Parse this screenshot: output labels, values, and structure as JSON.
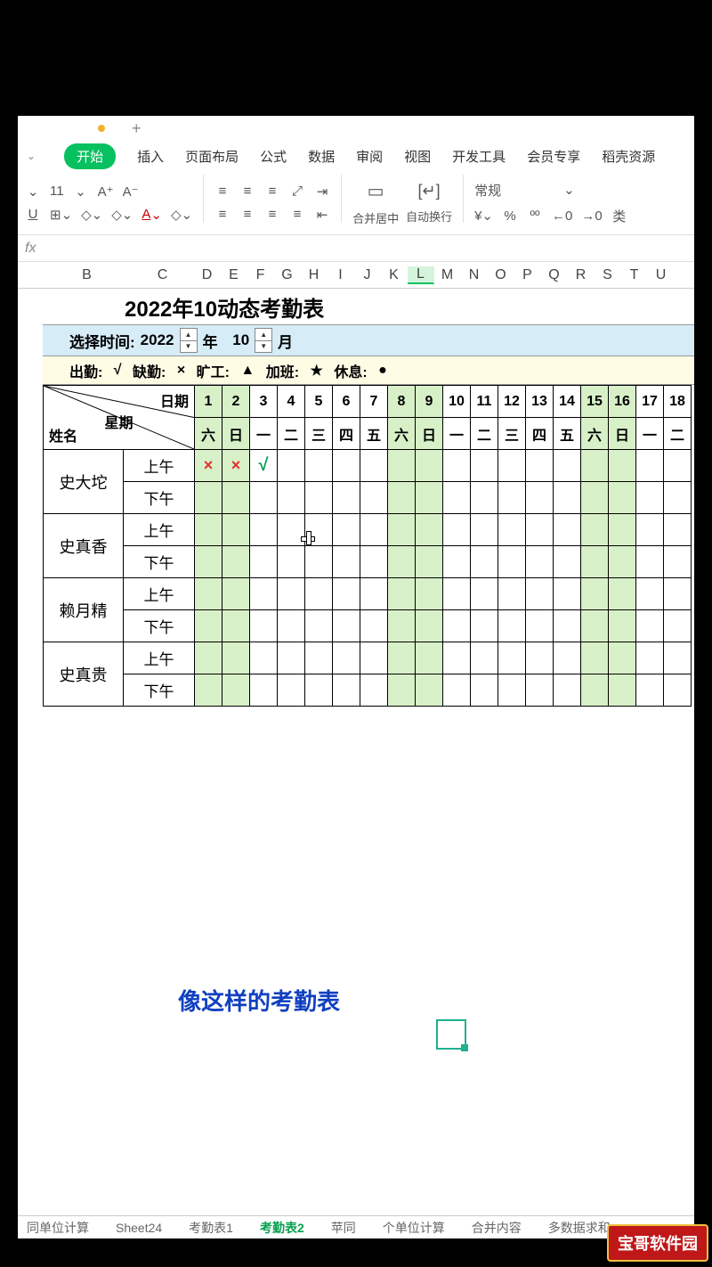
{
  "ribbon": {
    "tabs": [
      "开始",
      "插入",
      "页面布局",
      "公式",
      "数据",
      "审阅",
      "视图",
      "开发工具",
      "会员专享",
      "稻壳资源"
    ],
    "fontSize": "11",
    "mergeLabel": "合并居中",
    "wrapLabel": "自动换行",
    "formatLabel": "常规"
  },
  "fx": "fx",
  "cols": [
    "B",
    "C",
    "D",
    "E",
    "F",
    "G",
    "H",
    "I",
    "J",
    "K",
    "L",
    "M",
    "N",
    "O",
    "P",
    "Q",
    "R",
    "S",
    "T",
    "U"
  ],
  "selectedCol": "L",
  "title": "2022年10动态考勤表",
  "timeSelect": {
    "label": "选择时间:",
    "year": "2022",
    "yearUnit": "年",
    "month": "10",
    "monthUnit": "月"
  },
  "legend": {
    "attend": "出勤:",
    "attendSym": "√",
    "absent": "缺勤:",
    "absentSym": "×",
    "skip": "旷工:",
    "skipSym": "▲",
    "ot": "加班:",
    "otSym": "★",
    "rest": "休息:",
    "restSym": "●"
  },
  "headers": {
    "date": "日期",
    "week": "星期",
    "name": "姓名",
    "am": "上午",
    "pm": "下午"
  },
  "days": [
    "1",
    "2",
    "3",
    "4",
    "5",
    "6",
    "7",
    "8",
    "9",
    "10",
    "11",
    "12",
    "13",
    "14",
    "15",
    "16",
    "17",
    "18"
  ],
  "weekdays": [
    "六",
    "日",
    "一",
    "二",
    "三",
    "四",
    "五",
    "六",
    "日",
    "一",
    "二",
    "三",
    "四",
    "五",
    "六",
    "日",
    "一",
    "二"
  ],
  "weekendIdx": [
    0,
    1,
    7,
    8,
    14,
    15
  ],
  "names": [
    "史大坨",
    "史真香",
    "赖月精",
    "史真贵"
  ],
  "marks": {
    "r0am": [
      "×",
      "×",
      "√"
    ]
  },
  "subtitle": "像这样的考勤表",
  "sheetTabs": [
    "同单位计算",
    "Sheet24",
    "考勤表1",
    "考勤表2",
    "苹同",
    "个单位计算",
    "合并内容",
    "多数据求和"
  ],
  "activeSheet": "考勤表2",
  "watermark": "宝哥软件园"
}
